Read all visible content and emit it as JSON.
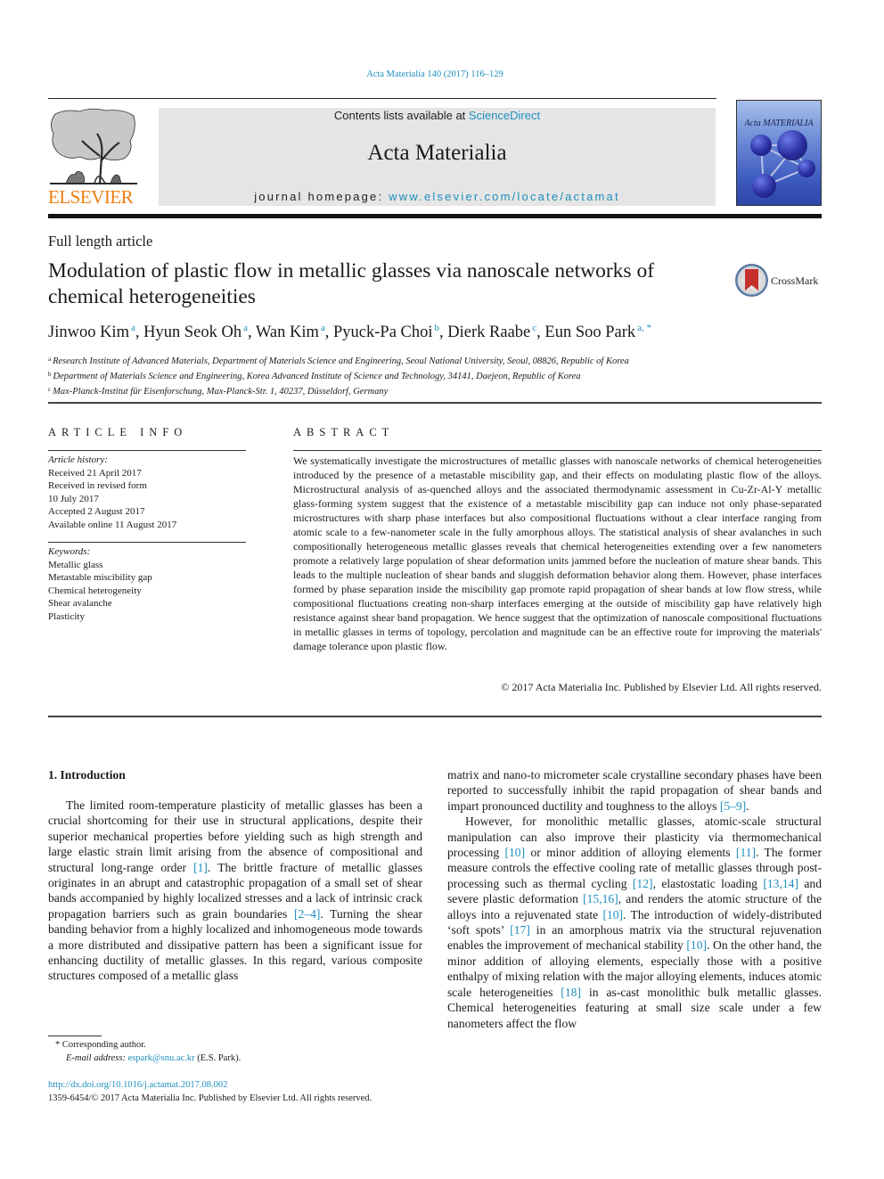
{
  "running_head": "Acta Materialia 140 (2017) 116–129",
  "masthead": {
    "publisher_wordmark": "ELSEVIER",
    "contents_prefix": "Contents lists available at ",
    "contents_link": "ScienceDirect",
    "journal_name": "Acta Materialia",
    "homepage_prefix": "journal homepage: ",
    "homepage_link": "www.elsevier.com/locate/actamat",
    "cover_title": "Acta MATERIALIA"
  },
  "crossmark_label": "CrossMark",
  "article_type": "Full length article",
  "title": "Modulation of plastic flow in metallic glasses via nanoscale networks of chemical heterogeneities",
  "authors": [
    {
      "name": "Jinwoo Kim",
      "aff": "a"
    },
    {
      "name": "Hyun Seok Oh",
      "aff": "a"
    },
    {
      "name": "Wan Kim",
      "aff": "a"
    },
    {
      "name": "Pyuck-Pa Choi",
      "aff": "b"
    },
    {
      "name": "Dierk Raabe",
      "aff": "c"
    },
    {
      "name": "Eun Soo Park",
      "aff": "a, *"
    }
  ],
  "affiliations": [
    {
      "key": "a",
      "text": "Research Institute of Advanced Materials, Department of Materials Science and Engineering, Seoul National University, Seoul, 08826, Republic of Korea"
    },
    {
      "key": "b",
      "text": "Department of Materials Science and Engineering, Korea Advanced Institute of Science and Technology, 34141, Daejeon, Republic of Korea"
    },
    {
      "key": "c",
      "text": "Max-Planck-Institut für Eisenforschung, Max-Planck-Str. 1, 40237, Düsseldorf, Germany"
    }
  ],
  "article_info": {
    "heading": "ARTICLE INFO",
    "history_heading": "Article history:",
    "history": [
      "Received 21 April 2017",
      "Received in revised form",
      "10 July 2017",
      "Accepted 2 August 2017",
      "Available online 11 August 2017"
    ],
    "keywords_heading": "Keywords:",
    "keywords": [
      "Metallic glass",
      "Metastable miscibility gap",
      "Chemical heterogeneity",
      "Shear avalanche",
      "Plasticity"
    ]
  },
  "abstract": {
    "heading": "ABSTRACT",
    "text": "We systematically investigate the microstructures of metallic glasses with nanoscale networks of chemical heterogeneities introduced by the presence of a metastable miscibility gap, and their effects on modulating plastic flow of the alloys. Microstructural analysis of as-quenched alloys and the associated thermodynamic assessment in Cu-Zr-Al-Y metallic glass-forming system suggest that the existence of a metastable miscibility gap can induce not only phase-separated microstructures with sharp phase in­terfaces but also compositional fluctuations without a clear interface ranging from atomic scale to a few-nanometer scale in the fully amorphous alloys. The statistical analysis of shear avalanches in such compositionally heterogeneous metallic glasses reveals that chemical heterogeneities extending over a few nanometers promote a relatively large population of shear deformation units jammed before the nucleation of mature shear bands. This leads to the multiple nucleation of shear bands and sluggish deformation behavior along them. However, phase interfaces formed by phase separation inside the miscibility gap promote rapid propagation of shear bands at low flow stress, while compositional fluc­tuations creating non-sharp interfaces emerging at the outside of miscibility gap have relatively high resistance against shear band propagation. We hence suggest that the optimization of nanoscale compositional fluctuations in metallic glasses in terms of topology, percolation and magnitude can be an effective route for improving the materials' damage tolerance upon plastic flow.",
    "copyright": "© 2017 Acta Materialia Inc. Published by Elsevier Ltd. All rights reserved."
  },
  "introduction": {
    "heading": "1.  Introduction",
    "left_column": [
      {
        "t": "The limited room-temperature plasticity of metallic glasses has been a crucial shortcoming for their use in structural applications, despite their superior mechanical properties before yielding such as high strength and large elastic strain limit arising from the absence of compositional and structural long-range order "
      },
      {
        "ref": "[1]"
      },
      {
        "t": ". The brittle fracture of metallic glasses originates in an abrupt and catastrophic propagation of a small set of shear bands accompanied by highly localized stresses and a lack of intrinsic crack propagation barriers such as grain boundaries "
      },
      {
        "ref": "[2–4]"
      },
      {
        "t": ". Turning the shear banding behavior from a highly localized and inhomogeneous mode to­wards a more distributed and dissipative pattern has been a sig­nificant issue for enhancing ductility of metallic glasses. In this regard, various composite structures composed of a metallic glass"
      }
    ],
    "right_column_p1": [
      {
        "t": "matrix and nano-to micrometer scale crystalline secondary phases have been reported to successfully inhibit the rapid propagation of shear bands and impart pronounced ductility and toughness to the alloys "
      },
      {
        "ref": "[5–9]"
      },
      {
        "t": "."
      }
    ],
    "right_column_p2": [
      {
        "t": "However, for monolithic metallic glasses, atomic-scale struc­tural manipulation can also improve their plasticity via thermo­mechanical processing "
      },
      {
        "ref": "[10]"
      },
      {
        "t": " or minor addition of alloying elements "
      },
      {
        "ref": "[11]"
      },
      {
        "t": ". The former measure controls the effective cooling rate of metallic glasses through post-processing such as thermal cycling "
      },
      {
        "ref": "[12]"
      },
      {
        "t": ", elastostatic loading "
      },
      {
        "ref": "[13,14]"
      },
      {
        "t": " and severe plastic deformation "
      },
      {
        "ref": "[15,16]"
      },
      {
        "t": ", and renders the atomic structure of the alloys into a reju­venated state "
      },
      {
        "ref": "[10]"
      },
      {
        "t": ". The introduction of widely-distributed ‘soft spots’ "
      },
      {
        "ref": "[17]"
      },
      {
        "t": " in an amorphous matrix via the structural rejuvenation enables the improvement of mechanical stability "
      },
      {
        "ref": "[10]"
      },
      {
        "t": ". On the other hand, the minor addition of alloying elements, especially those with a positive enthalpy of mixing relation with the major alloying elements, induces atomic scale heterogeneities "
      },
      {
        "ref": "[18]"
      },
      {
        "t": " in as-cast monolithic bulk metallic glasses. Chemical heterogeneities featuring at small size scale under a few nanometers affect the flow"
      }
    ]
  },
  "footnotes": {
    "corresponding": "* Corresponding author.",
    "email_label": "E-mail address:",
    "email": "espark@snu.ac.kr",
    "email_suffix": " (E.S. Park).",
    "doi": "http://dx.doi.org/10.1016/j.actamat.2017.08.002",
    "issn_line": "1359-6454/© 2017 Acta Materialia Inc. Published by Elsevier Ltd. All rights reserved."
  }
}
